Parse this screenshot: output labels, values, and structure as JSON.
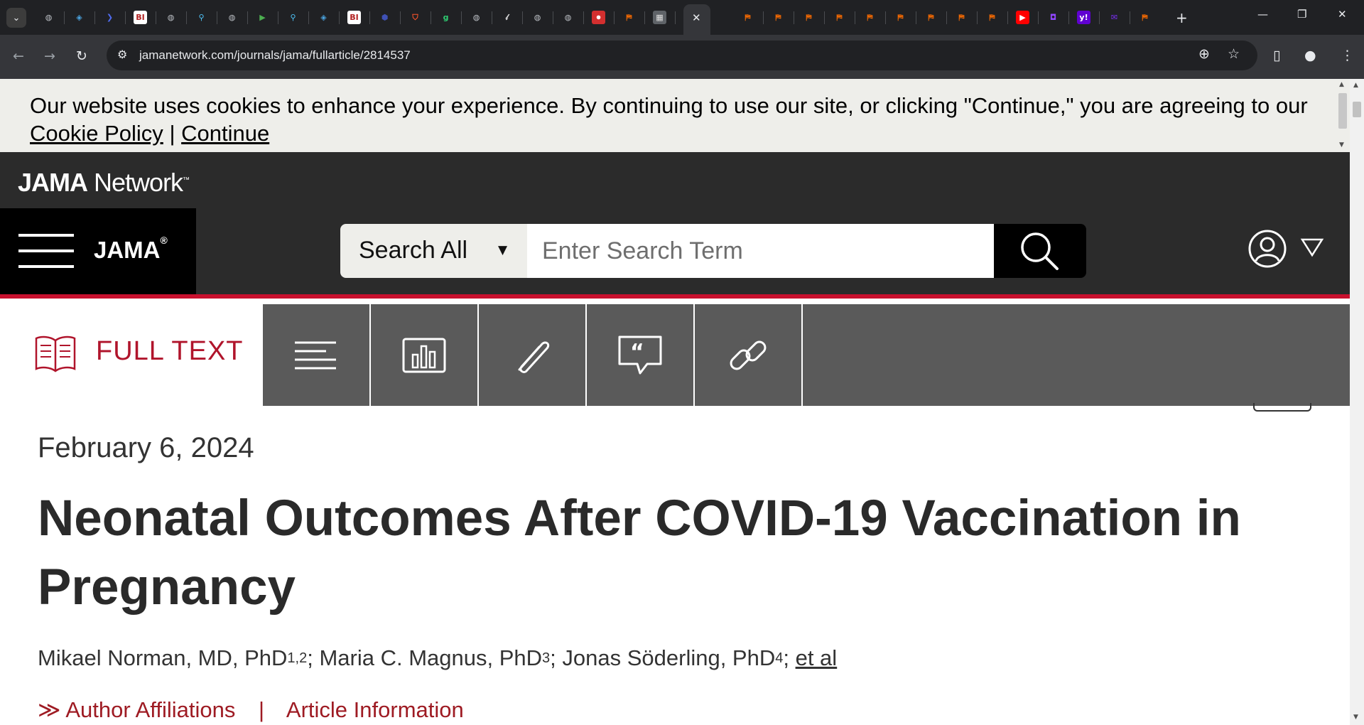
{
  "browser": {
    "url": "jamanetwork.com/journals/jama/fullarticle/2814537",
    "active_tab_close": "✕",
    "new_tab": "+",
    "favicons": [
      {
        "name": "globe-favicon",
        "glyph": "◍",
        "bg": "#202124",
        "fg": "#bdc1c6"
      },
      {
        "name": "shield-favicon",
        "glyph": "◈",
        "bg": "#202124",
        "fg": "#4aa3df"
      },
      {
        "name": "chevron-favicon",
        "glyph": "❯",
        "bg": "#202124",
        "fg": "#4f6bed"
      },
      {
        "name": "bi-favicon",
        "glyph": "BI",
        "bg": "#ffffff",
        "fg": "#b22222"
      },
      {
        "name": "globe-favicon",
        "glyph": "◍",
        "bg": "#202124",
        "fg": "#bdc1c6"
      },
      {
        "name": "search-favicon",
        "glyph": "⚲",
        "bg": "#202124",
        "fg": "#4fc3f7"
      },
      {
        "name": "globe-favicon",
        "glyph": "◍",
        "bg": "#202124",
        "fg": "#bdc1c6"
      },
      {
        "name": "play-favicon",
        "glyph": "▶",
        "bg": "#202124",
        "fg": "#4caf50"
      },
      {
        "name": "search-favicon",
        "glyph": "⚲",
        "bg": "#202124",
        "fg": "#4fc3f7"
      },
      {
        "name": "shield-favicon",
        "glyph": "◈",
        "bg": "#202124",
        "fg": "#4aa3df"
      },
      {
        "name": "bi-favicon",
        "glyph": "BI",
        "bg": "#ffffff",
        "fg": "#b22222"
      },
      {
        "name": "hex-favicon",
        "glyph": "⬢",
        "bg": "#202124",
        "fg": "#3f51b5"
      },
      {
        "name": "brave-favicon",
        "glyph": "⛉",
        "bg": "#202124",
        "fg": "#fb542b"
      },
      {
        "name": "g-favicon",
        "glyph": "g",
        "bg": "#202124",
        "fg": "#2ecc71"
      },
      {
        "name": "globe-favicon",
        "glyph": "◍",
        "bg": "#202124",
        "fg": "#bdc1c6"
      },
      {
        "name": "script-favicon",
        "glyph": "𝓁",
        "bg": "#202124",
        "fg": "#dddddd"
      },
      {
        "name": "globe-favicon",
        "glyph": "◍",
        "bg": "#202124",
        "fg": "#bdc1c6"
      },
      {
        "name": "globe-favicon",
        "glyph": "◍",
        "bg": "#202124",
        "fg": "#bdc1c6"
      },
      {
        "name": "mic-favicon",
        "glyph": "⏺",
        "bg": "#d32f2f",
        "fg": "#ffffff"
      },
      {
        "name": "bookmark-favicon",
        "glyph": "⛿",
        "bg": "#202124",
        "fg": "#ff6d00"
      },
      {
        "name": "image-favicon",
        "glyph": "▦",
        "bg": "#5f6368",
        "fg": "#e0e0e0"
      },
      {
        "name": "dark-favicon",
        "glyph": "◣",
        "bg": "#0b1b3a",
        "fg": "#8ab4f8"
      },
      {
        "name": "bookmark-favicon",
        "glyph": "⛿",
        "bg": "#202124",
        "fg": "#ff6d00"
      },
      {
        "name": "bookmark-favicon",
        "glyph": "⛿",
        "bg": "#202124",
        "fg": "#ff6d00"
      },
      {
        "name": "bookmark-favicon",
        "glyph": "⛿",
        "bg": "#202124",
        "fg": "#ff6d00"
      },
      {
        "name": "bookmark-favicon",
        "glyph": "⛿",
        "bg": "#202124",
        "fg": "#ff6d00"
      },
      {
        "name": "bookmark-favicon",
        "glyph": "⛿",
        "bg": "#202124",
        "fg": "#ff6d00"
      },
      {
        "name": "bookmark-favicon",
        "glyph": "⛿",
        "bg": "#202124",
        "fg": "#ff6d00"
      },
      {
        "name": "bookmark-favicon",
        "glyph": "⛿",
        "bg": "#202124",
        "fg": "#ff6d00"
      },
      {
        "name": "bookmark-favicon",
        "glyph": "⛿",
        "bg": "#202124",
        "fg": "#ff6d00"
      },
      {
        "name": "bookmark-favicon",
        "glyph": "⛿",
        "bg": "#202124",
        "fg": "#ff6d00"
      },
      {
        "name": "youtube-favicon",
        "glyph": "▶",
        "bg": "#ff0000",
        "fg": "#ffffff"
      },
      {
        "name": "twitch-favicon",
        "glyph": "◘",
        "bg": "#202124",
        "fg": "#9146ff"
      },
      {
        "name": "yahoo-favicon",
        "glyph": "y!",
        "bg": "#6001d2",
        "fg": "#ffffff"
      },
      {
        "name": "mail-favicon",
        "glyph": "✉",
        "bg": "#202124",
        "fg": "#7b2ff7"
      },
      {
        "name": "bookmark-favicon",
        "glyph": "⛿",
        "bg": "#202124",
        "fg": "#ff6d00"
      }
    ]
  },
  "cookie_banner": {
    "message": "Our website uses cookies to enhance your experience. By continuing to use our site, or clicking \"Continue,\" you are agreeing to our",
    "policy_link": "Cookie Policy",
    "separator": "|",
    "continue_link": "Continue"
  },
  "site_header": {
    "network_brand_bold": "JAMA",
    "network_brand_light": " Network",
    "network_brand_tm": "™",
    "journal": "JAMA",
    "journal_reg": "®"
  },
  "search": {
    "scope": "Search All",
    "placeholder": "Enter Search Term"
  },
  "article_toolbar": {
    "full_text_label": "FULL TEXT",
    "tools": [
      {
        "name": "outline-tool-button"
      },
      {
        "name": "figures-tool-button"
      },
      {
        "name": "supplemental-tool-button"
      },
      {
        "name": "cite-tool-button"
      },
      {
        "name": "permalink-tool-button"
      }
    ]
  },
  "article": {
    "date": "February 6, 2024",
    "title": "Neonatal Outcomes After COVID-19 Vaccination in Pregnancy",
    "authors": [
      {
        "name": "Mikael Norman, MD, PhD",
        "sup": "1,2"
      },
      {
        "name": "Maria C. Magnus, PhD",
        "sup": "3"
      },
      {
        "name": "Jonas Söderling, PhD",
        "sup": "4"
      }
    ],
    "author_sep": "; ",
    "et_al": "et al",
    "affiliations_link": "Author Affiliations",
    "affiliations_arrow": "≫",
    "pipe": "|",
    "info_link": "Article Information"
  },
  "colors": {
    "accent_red": "#c8102e",
    "link_red": "#9e1b23",
    "header_dark": "#2b2b2b",
    "toolbar_gray": "#5a5a5a"
  }
}
